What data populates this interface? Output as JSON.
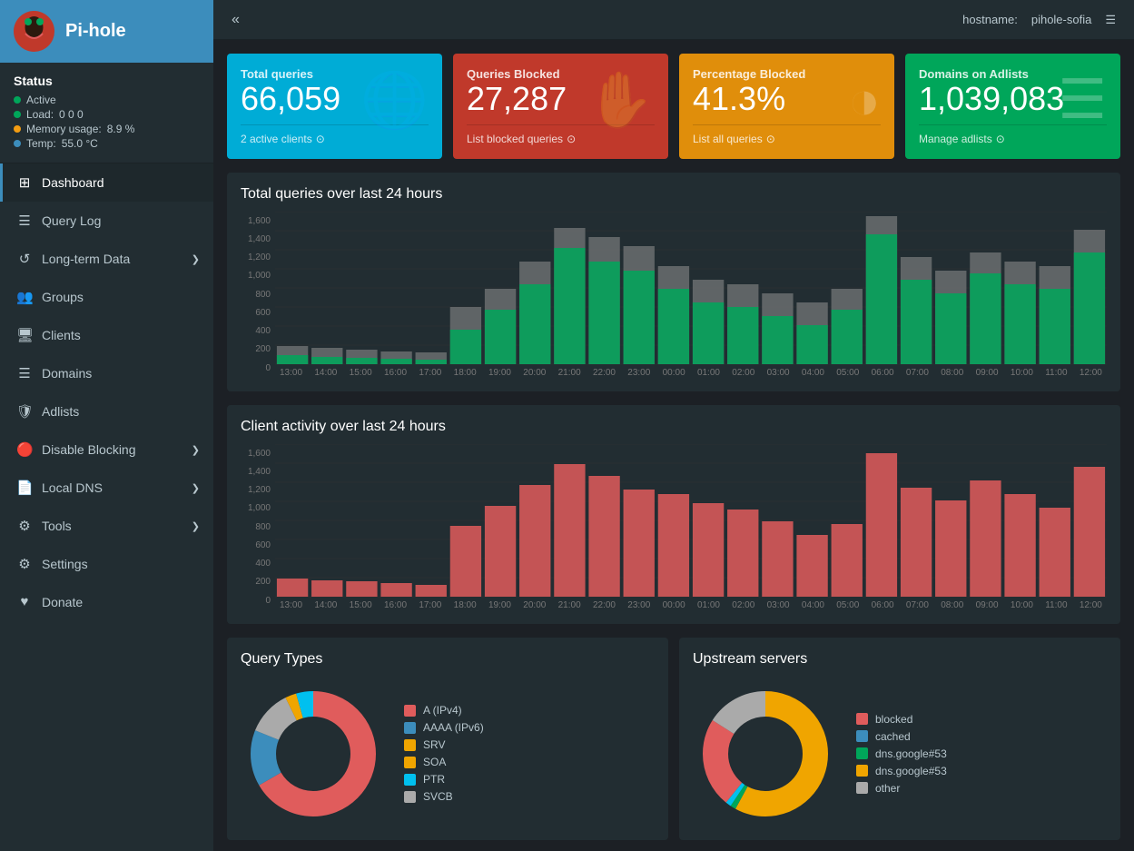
{
  "app": {
    "title": "Pi-hole",
    "hostname_label": "hostname:",
    "hostname_value": "pihole-sofia"
  },
  "sidebar": {
    "collapse_icon": "«",
    "menu_icon": "☰",
    "status": {
      "title": "Status",
      "active_label": "Active",
      "load_label": "Load:",
      "load_value": "0  0  0",
      "memory_label": "Memory usage:",
      "memory_value": "8.9 %",
      "temp_label": "Temp:",
      "temp_value": "55.0 °C"
    },
    "nav_items": [
      {
        "id": "dashboard",
        "label": "Dashboard",
        "icon": "⊞",
        "active": true
      },
      {
        "id": "query-log",
        "label": "Query Log",
        "icon": "☰"
      },
      {
        "id": "long-term-data",
        "label": "Long-term Data",
        "icon": "↺",
        "has_chevron": true
      },
      {
        "id": "groups",
        "label": "Groups",
        "icon": "👥"
      },
      {
        "id": "clients",
        "label": "Clients",
        "icon": "🖥"
      },
      {
        "id": "domains",
        "label": "Domains",
        "icon": "☰"
      },
      {
        "id": "adlists",
        "label": "Adlists",
        "icon": "🛡"
      },
      {
        "id": "disable-blocking",
        "label": "Disable Blocking",
        "icon": "🔴",
        "has_chevron": true
      },
      {
        "id": "local-dns",
        "label": "Local DNS",
        "icon": "📄",
        "has_chevron": true
      },
      {
        "id": "tools",
        "label": "Tools",
        "icon": "⚙",
        "has_chevron": true
      },
      {
        "id": "settings",
        "label": "Settings",
        "icon": "⚙"
      },
      {
        "id": "donate",
        "label": "Donate",
        "icon": "♥"
      }
    ]
  },
  "stat_cards": [
    {
      "id": "total-queries",
      "title": "Total queries",
      "value": "66,059",
      "footer": "2 active clients",
      "footer_icon": "→",
      "color": "blue"
    },
    {
      "id": "queries-blocked",
      "title": "Queries Blocked",
      "value": "27,287",
      "footer": "List blocked queries",
      "footer_icon": "→",
      "color": "red"
    },
    {
      "id": "percentage-blocked",
      "title": "Percentage Blocked",
      "value": "41.3%",
      "footer": "List all queries",
      "footer_icon": "→",
      "color": "orange"
    },
    {
      "id": "domains-adlists",
      "title": "Domains on Adlists",
      "value": "1,039,083",
      "footer": "Manage adlists",
      "footer_icon": "→",
      "color": "green"
    }
  ],
  "charts": {
    "total_queries": {
      "title": "Total queries over last 24 hours",
      "y_labels": [
        "1,600",
        "1,400",
        "1,200",
        "1,000",
        "800",
        "600",
        "400",
        "200",
        "0"
      ],
      "x_labels": [
        "13:00",
        "14:00",
        "15:00",
        "16:00",
        "17:00",
        "18:00",
        "19:00",
        "20:00",
        "21:00",
        "22:00",
        "23:00",
        "00:00",
        "01:00",
        "02:00",
        "03:00",
        "04:00",
        "05:00",
        "06:00",
        "07:00",
        "08:00",
        "09:00",
        "10:00",
        "11:00",
        "12:00"
      ]
    },
    "client_activity": {
      "title": "Client activity over last 24 hours",
      "y_labels": [
        "1,600",
        "1,400",
        "1,200",
        "1,000",
        "800",
        "600",
        "400",
        "200",
        "0"
      ],
      "x_labels": [
        "13:00",
        "14:00",
        "15:00",
        "16:00",
        "17:00",
        "18:00",
        "19:00",
        "20:00",
        "21:00",
        "22:00",
        "23:00",
        "00:00",
        "01:00",
        "02:00",
        "03:00",
        "04:00",
        "05:00",
        "06:00",
        "07:00",
        "08:00",
        "09:00",
        "10:00",
        "11:00",
        "12:00"
      ]
    }
  },
  "query_types": {
    "title": "Query Types",
    "legend": [
      {
        "label": "A (IPv4)",
        "color": "#e05c5c"
      },
      {
        "label": "AAAA (IPv6)",
        "color": "#3c8dbc"
      },
      {
        "label": "SRV",
        "color": "#f0a500"
      },
      {
        "label": "SOA",
        "color": "#f0a500"
      },
      {
        "label": "PTR",
        "color": "#00c0ef"
      },
      {
        "label": "SVCB",
        "color": "#aaa"
      }
    ]
  },
  "upstream_servers": {
    "title": "Upstream servers",
    "legend": [
      {
        "label": "blocked",
        "color": "#e05c5c"
      },
      {
        "label": "cached",
        "color": "#3c8dbc"
      },
      {
        "label": "dns.google#53",
        "color": "#00a65a"
      },
      {
        "label": "dns.google#53",
        "color": "#f0a500"
      },
      {
        "label": "other",
        "color": "#aaa"
      }
    ]
  }
}
